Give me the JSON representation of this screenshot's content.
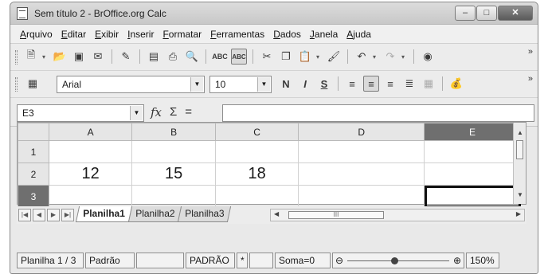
{
  "window": {
    "title": "Sem título 2 - BrOffice.org Calc",
    "controls": {
      "minimize": "–",
      "maximize": "□",
      "close": "✕"
    }
  },
  "menu": [
    "Arquivo",
    "Editar",
    "Exibir",
    "Inserir",
    "Formatar",
    "Ferramentas",
    "Dados",
    "Janela",
    "Ajuda"
  ],
  "toolbar_standard": {
    "icons": [
      "new-icon",
      "open-icon",
      "save-icon",
      "email-icon",
      "edit-file-icon",
      "export-pdf-icon",
      "print-icon",
      "page-preview-icon",
      "spellcheck-icon",
      "autospellcheck-icon",
      "cut-icon",
      "copy-icon",
      "paste-icon",
      "clone-format-icon",
      "undo-icon",
      "redo-icon",
      "navigator-icon"
    ],
    "overflow": "»"
  },
  "toolbar_format": {
    "font_name": "Arial",
    "font_size": "10",
    "bold": "N",
    "italic": "I",
    "underline": "S",
    "overflow": "»"
  },
  "formula_bar": {
    "name_box": "E3",
    "fx": "fx",
    "sum": "Σ",
    "equals": "=",
    "content": ""
  },
  "sheet": {
    "columns": [
      "A",
      "B",
      "C",
      "D",
      "E"
    ],
    "selected_column": "E",
    "rows": [
      {
        "header": "1",
        "cells": [
          "",
          "",
          "",
          "",
          ""
        ]
      },
      {
        "header": "2",
        "cells": [
          "12",
          "15",
          "18",
          "",
          ""
        ]
      },
      {
        "header": "3",
        "cells": [
          "",
          "",
          "",
          "",
          ""
        ]
      }
    ],
    "selected_row": "3",
    "selected_cell": "E3"
  },
  "tabs": {
    "items": [
      "Planilha1",
      "Planilha2",
      "Planilha3"
    ],
    "active": "Planilha1",
    "hscroll_thumb": "III"
  },
  "status": {
    "sheet": "Planilha 1 / 3",
    "page_style": "Padrão",
    "blank1": "",
    "insert_mode": "PADRÃO",
    "modified": "*",
    "blank2": "",
    "sum": "Soma=0",
    "zoom_minus": "⊖",
    "zoom_plus": "⊕",
    "zoom_level_fraction": 0.45,
    "zoom": "150%"
  }
}
